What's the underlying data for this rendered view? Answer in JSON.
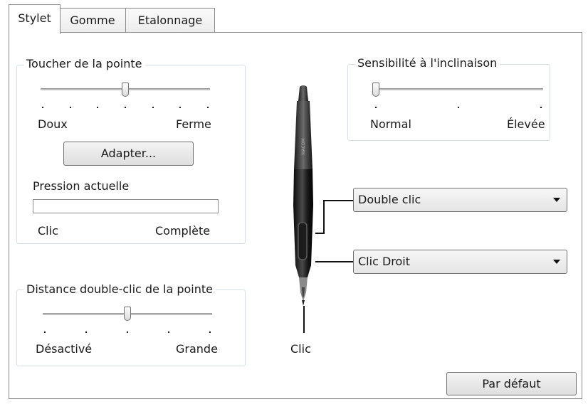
{
  "tabs": [
    {
      "label": "Stylet",
      "active": true
    },
    {
      "label": "Gomme",
      "active": false
    },
    {
      "label": "Etalonnage",
      "active": false
    }
  ],
  "tip_feel": {
    "title": "Toucher de la pointe",
    "min_label": "Doux",
    "max_label": "Ferme",
    "level_fraction": 0.5,
    "button_label": "Adapter...",
    "pressure_title": "Pression actuelle",
    "pressure_value": 0,
    "pressure_min_label": "Clic",
    "pressure_max_label": "Complète"
  },
  "double_click_distance": {
    "title": "Distance double-clic de la pointe",
    "min_label": "Désactivé",
    "max_label": "Grande",
    "level_fraction": 0.5
  },
  "tilt_sensitivity": {
    "title": "Sensibilité à l'inclinaison",
    "min_label": "Normal",
    "max_label": "Élevée",
    "level_fraction": 0.0
  },
  "pen": {
    "upper_button_value": "Double clic",
    "lower_button_value": "Clic Droit",
    "tip_label": "Clic"
  },
  "default_button_label": "Par défaut"
}
